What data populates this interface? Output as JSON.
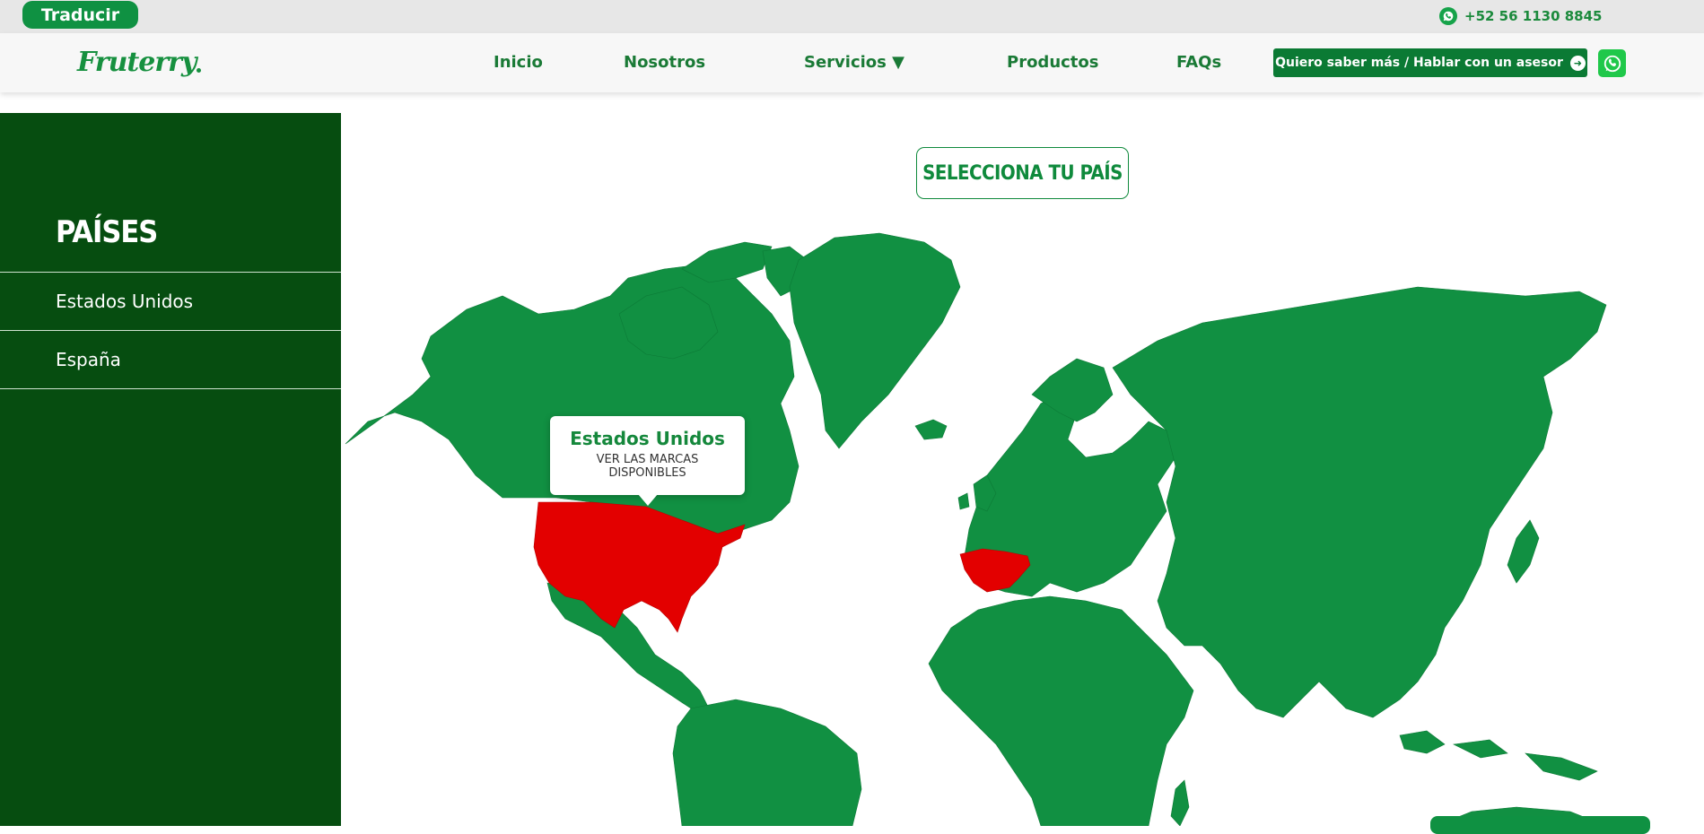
{
  "topbar": {
    "translate_label": "Traducir",
    "phone": "+52 56 1130 8845"
  },
  "brand": {
    "logo_text": "Fruterry",
    "accent": "#0f9142",
    "dark_green": "#064d10",
    "highlight": "#e30000"
  },
  "nav": {
    "items": [
      "Inicio",
      "Nosotros",
      "Servicios ▼",
      "Productos",
      "FAQs"
    ],
    "cta_label": "Quiero saber más / Hablar con un asesor"
  },
  "sidebar": {
    "title": "PAÍSES",
    "countries": [
      "Estados Unidos",
      "España"
    ]
  },
  "main": {
    "select_label": "SELECCIONA TU PAÍS",
    "highlighted_countries": [
      "Estados Unidos",
      "España"
    ],
    "tooltip": {
      "title": "Estados Unidos",
      "subtitle": "VER LAS MARCAS DISPONIBLES"
    }
  }
}
